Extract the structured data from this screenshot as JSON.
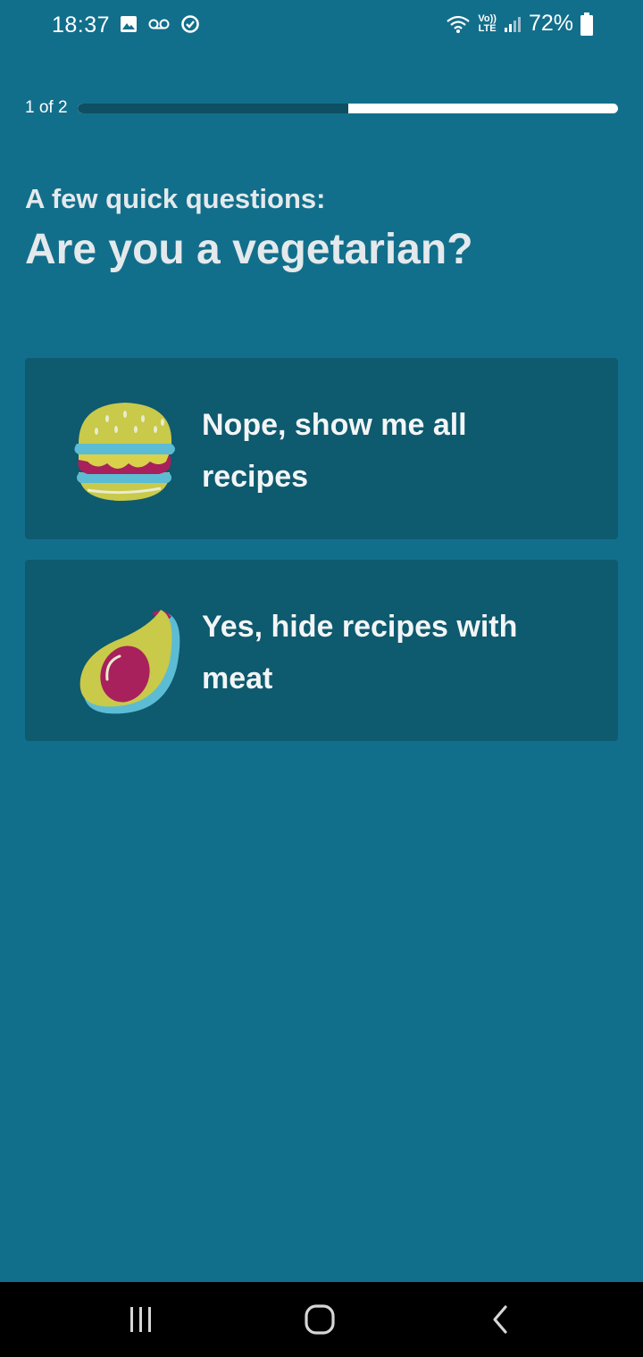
{
  "status_bar": {
    "time": "18:37",
    "battery_percent": "72%",
    "left_icons": [
      "gallery-icon",
      "voicemail-icon",
      "sync-icon"
    ],
    "right_icons": [
      "wifi-icon",
      "volte-icon",
      "signal-icon",
      "battery-icon"
    ],
    "volte_text": [
      "Vo))",
      "LTE"
    ]
  },
  "progress": {
    "label": "1 of 2",
    "fraction": 0.5
  },
  "question": {
    "subtitle": "A few quick questions:",
    "title": "Are you a vegetarian?"
  },
  "options": [
    {
      "label": "Nope, show me all recipes",
      "icon": "burger-icon"
    },
    {
      "label": "Yes, hide recipes with meat",
      "icon": "avocado-icon"
    }
  ],
  "nav_bar": {
    "buttons": [
      "recent-apps-icon",
      "home-icon",
      "back-icon"
    ]
  },
  "colors": {
    "background": "#126f8b",
    "card": "#0e5a6f",
    "progress_fill": "#0e4f63",
    "progress_track": "#ffffff",
    "heading": "#e4e9ec"
  }
}
